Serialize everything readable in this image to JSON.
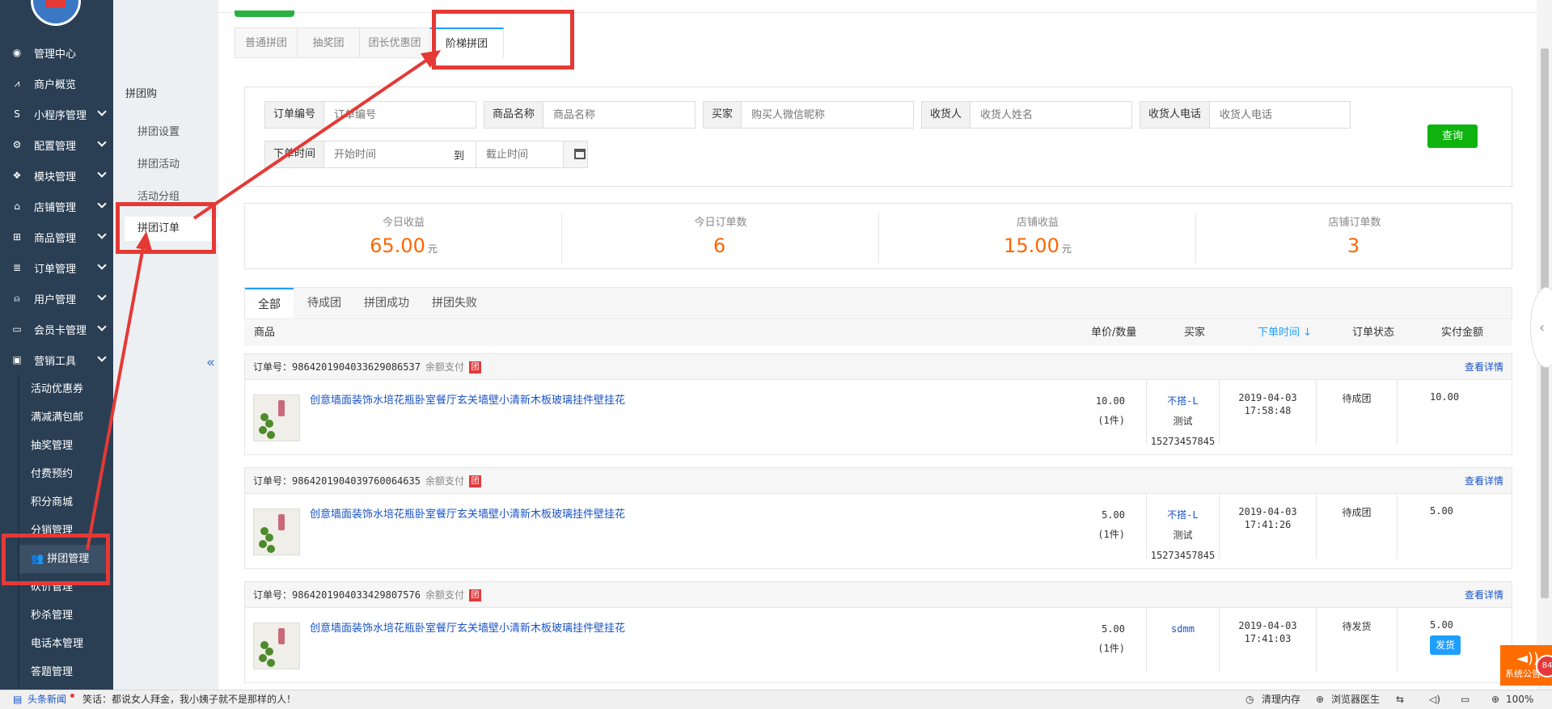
{
  "leftnav": {
    "items": [
      {
        "icon": "dashboard-icon",
        "glyph": "◉",
        "label": "管理中心",
        "chev": false
      },
      {
        "icon": "chart-line-icon",
        "glyph": "⩘",
        "label": "商户概览",
        "chev": false
      },
      {
        "icon": "miniprogram-icon",
        "glyph": "S",
        "label": "小程序管理",
        "chev": true
      },
      {
        "icon": "cogs-icon",
        "glyph": "⚙",
        "label": "配置管理",
        "chev": true
      },
      {
        "icon": "modules-icon",
        "glyph": "❖",
        "label": "模块管理",
        "chev": true
      },
      {
        "icon": "bank-icon",
        "glyph": "⌂",
        "label": "店铺管理",
        "chev": true
      },
      {
        "icon": "cart-icon",
        "glyph": "⊞",
        "label": "商品管理",
        "chev": true
      },
      {
        "icon": "orders-icon",
        "glyph": "≣",
        "label": "订单管理",
        "chev": true
      },
      {
        "icon": "user-icon",
        "glyph": "⍝",
        "label": "用户管理",
        "chev": true
      },
      {
        "icon": "card-icon",
        "glyph": "▭",
        "label": "会员卡管理",
        "chev": true
      },
      {
        "icon": "briefcase-icon",
        "glyph": "▣",
        "label": "营销工具",
        "chev": true
      }
    ],
    "sub_items": [
      "活动优惠券",
      "满减满包邮",
      "抽奖管理",
      "付费预约",
      "积分商城",
      "分销管理",
      "拼团管理",
      "砍价管理",
      "秒杀管理",
      "电话本管理",
      "答题管理"
    ]
  },
  "subnav": {
    "header": "拼团购",
    "items": [
      "拼团设置",
      "拼团活动",
      "活动分组",
      "拼团订单"
    ]
  },
  "tabs": [
    "普通拼团",
    "抽奖团",
    "团长优惠团",
    "阶梯拼团"
  ],
  "search": {
    "order_no": {
      "label": "订单编号",
      "placeholder": "订单编号"
    },
    "goods_name": {
      "label": "商品名称",
      "placeholder": "商品名称"
    },
    "buyer": {
      "label": "买家",
      "placeholder": "购买人微信昵称"
    },
    "receiver": {
      "label": "收货人",
      "placeholder": "收货人姓名"
    },
    "receiver_phone": {
      "label": "收货人电话",
      "placeholder": "收货人电话"
    },
    "time_label": "下单时间",
    "start_placeholder": "开始时间",
    "to": "到",
    "end_placeholder": "截止时间",
    "query_btn": "查询"
  },
  "stats": [
    {
      "title": "今日收益",
      "value": "65.00",
      "unit": "元"
    },
    {
      "title": "今日订单数",
      "value": "6",
      "unit": ""
    },
    {
      "title": "店铺收益",
      "value": "15.00",
      "unit": "元"
    },
    {
      "title": "店铺订单数",
      "value": "3",
      "unit": ""
    }
  ],
  "order_tabs": [
    "全部",
    "待成团",
    "拼团成功",
    "拼团失败"
  ],
  "table_header": {
    "goods": "商品",
    "price_qty": "单价/数量",
    "buyer": "买家",
    "order_time": "下单时间",
    "sort_glyph": "↓",
    "status": "订单状态",
    "amount": "实付金额"
  },
  "orders": [
    {
      "order_no_label": "订单号：",
      "order_no": "9864201904033629086537",
      "pay": "余额支付",
      "badge": "团",
      "detail": "查看详情",
      "goods": "创意墙面装饰水培花瓶卧室餐厅玄关墙壁小清新木板玻璃挂件壁挂花",
      "price": "10.00",
      "qty": "(1件)",
      "buyer_name": "不搭-L",
      "buyer_sub": "测试",
      "buyer_phone": "15273457845",
      "date": "2019-04-03",
      "time": "17:58:48",
      "status": "待成团",
      "amount": "10.00"
    },
    {
      "order_no_label": "订单号：",
      "order_no": "9864201904039760064635",
      "pay": "余额支付",
      "badge": "团",
      "detail": "查看详情",
      "goods": "创意墙面装饰水培花瓶卧室餐厅玄关墙壁小清新木板玻璃挂件壁挂花",
      "price": "5.00",
      "qty": "(1件)",
      "buyer_name": "不搭-L",
      "buyer_sub": "测试",
      "buyer_phone": "15273457845",
      "date": "2019-04-03",
      "time": "17:41:26",
      "status": "待成团",
      "amount": "5.00"
    },
    {
      "order_no_label": "订单号：",
      "order_no": "9864201904033429807576",
      "pay": "余额支付",
      "badge": "团",
      "detail": "查看详情",
      "goods": "创意墙面装饰水培花瓶卧室餐厅玄关墙壁小清新木板玻璃挂件壁挂花",
      "price": "5.00",
      "qty": "(1件)",
      "buyer_name": "sdmm",
      "buyer_sub": "",
      "buyer_phone": "",
      "date": "2019-04-03",
      "time": "17:41:03",
      "status": "待发货",
      "amount": "5.00",
      "ship_btn": "发货"
    }
  ],
  "notice": {
    "label": "系统公告",
    "count": "84"
  },
  "statusbar": {
    "news_label": "头条新闻",
    "news_text": "笑话：都说女人拜金，我小姨子就不是那样的人！",
    "clean": "清理内存",
    "doctor": "浏览器医生",
    "zoom": "100%"
  },
  "colors": {
    "accent": "#1e9fff",
    "green": "#0fb30f",
    "orange": "#ff6600",
    "annotation_red": "#e53935",
    "nav_bg": "#2a3f54"
  }
}
